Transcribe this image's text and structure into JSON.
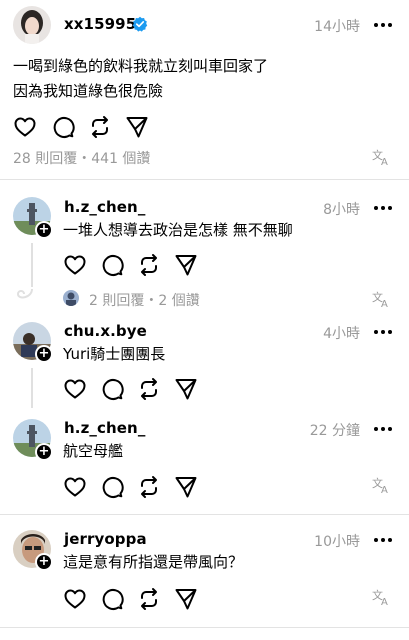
{
  "post": {
    "username": "xx15995",
    "time": "14小時",
    "lines": [
      "一喝到綠色的飲料我就立刻叫車回家了",
      "因為我知道綠色很危險"
    ],
    "stats": "28 則回覆・441 個讚"
  },
  "replies": [
    {
      "username": "h.z_chen_",
      "time": "8小時",
      "text": "一堆人想導去政治是怎樣 無不無聊",
      "sub_meta": "2 則回覆・2 個讚"
    },
    {
      "username": "chu.x.bye",
      "time": "4小時",
      "text": "Yuri騎士團團長"
    },
    {
      "username": "h.z_chen_",
      "time": "22 分鐘",
      "text": "航空母艦"
    },
    {
      "username": "jerryoppa",
      "time": "10小時",
      "text": "這是意有所指還是帶風向？"
    }
  ],
  "icons": {
    "like": "heart-icon",
    "comment": "comment-icon",
    "repost": "repost-icon",
    "share": "send-icon",
    "translate": "translate-icon",
    "verified": "verified-badge-icon",
    "more": "more-icon"
  },
  "colors": {
    "verified": "#1d9bf0",
    "muted": "#999999",
    "divider": "#e3e3e3"
  }
}
